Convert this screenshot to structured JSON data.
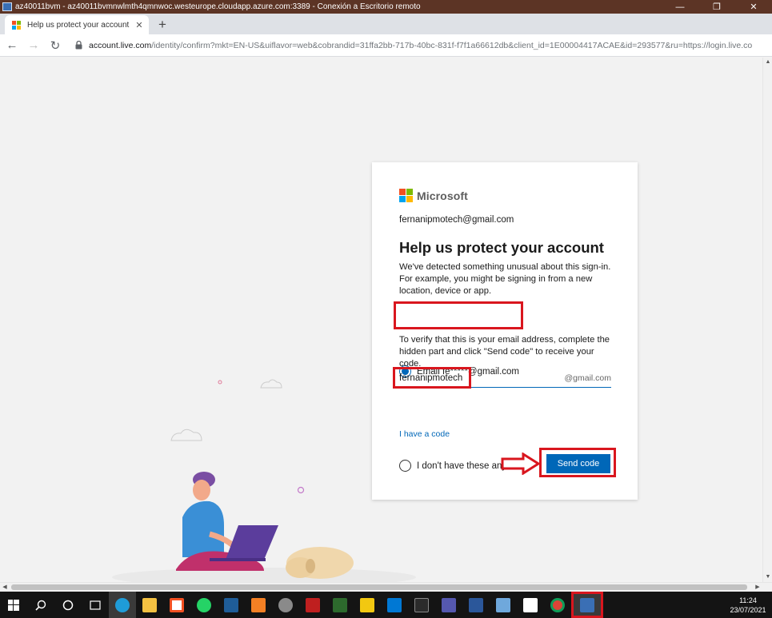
{
  "rdp": {
    "title": "az40011bvm - az40011bvmnwlmth4qmnwoc.westeurope.cloudapp.azure.com:3389 - Conexión a Escritorio remoto",
    "minimize": "—",
    "restore": "❐",
    "close": "✕"
  },
  "browser": {
    "tab_title": "Help us protect your account",
    "tab_close": "✕",
    "new_tab": "+",
    "url_host": "account.live.com",
    "url_path": "/identity/confirm?mkt=EN-US&uiflavor=web&cobrandid=31ffa2bb-717b-40bc-831f-f7f1a66612db&client_id=1E00004417ACAE&id=293577&ru=https://login.live.co",
    "back": "←",
    "forward": "→",
    "reload": "↻"
  },
  "card": {
    "brand": "Microsoft",
    "account": "fernanipmotech@gmail.com",
    "heading": "Help us protect your account",
    "description": "We've detected something unusual about this sign-in. For example, you might be signing in from a new location, device or app.",
    "option_email_label": "Email fe*****@gmail.com",
    "verify_text": "To verify that this is your email address, complete the hidden part and click \"Send code\" to receive your code.",
    "email_input_value": "fernanipmotech",
    "email_suffix": "@gmail.com",
    "option_none_label": "I don't have these any more",
    "have_code_link": "I have a code",
    "send_button": "Send code"
  },
  "colors": {
    "ms_red": "#f25022",
    "ms_green": "#7fba00",
    "ms_blue": "#00a4ef",
    "ms_yellow": "#ffb900",
    "accent": "#0067b8",
    "annotation_red": "#d9161e"
  },
  "taskbar": {
    "time": "11:24",
    "date": "23/07/2021",
    "apps": [
      "windows-start",
      "search",
      "cortana",
      "task-view",
      "edge",
      "file-explorer",
      "store",
      "whatsapp",
      "vmware",
      "powerpoint-like",
      "vpn",
      "filezilla",
      "terminal-green",
      "power-bi",
      "vscode",
      "cmd",
      "teams",
      "word",
      "screenshot",
      "typora",
      "chrome",
      "remote-desktop"
    ]
  }
}
